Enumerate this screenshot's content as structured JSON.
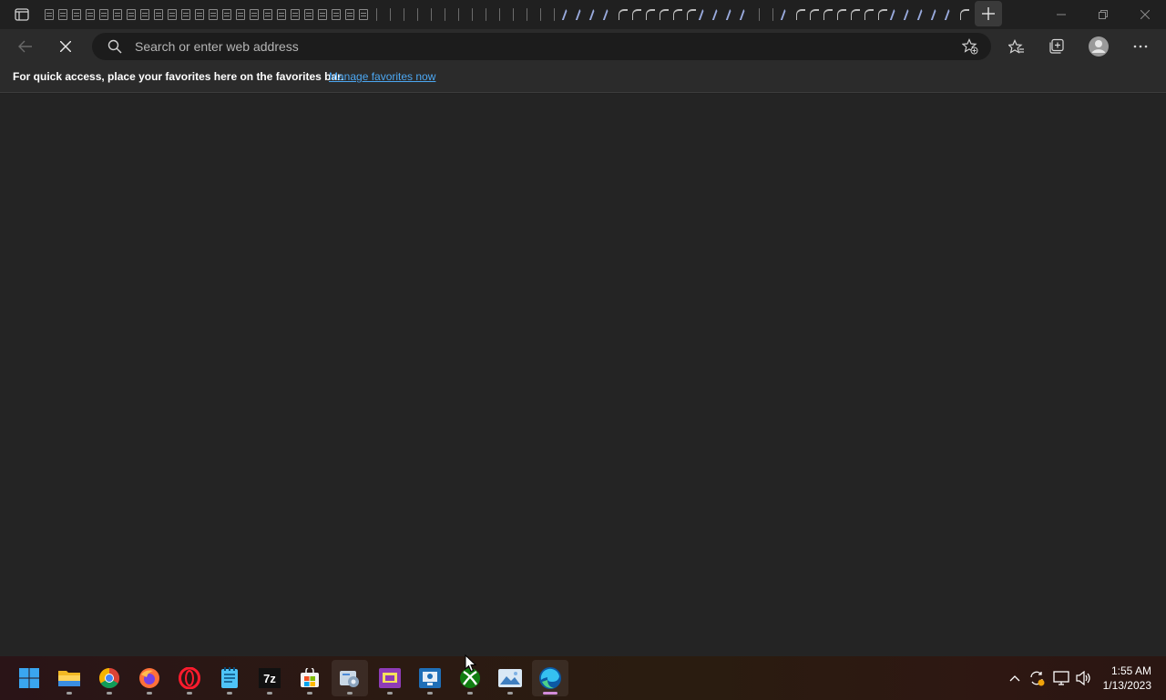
{
  "browser": {
    "address_placeholder": "Search or enter web address",
    "address_value": "",
    "favorites_bar": {
      "message": "For quick access, place your favorites here on the favorites bar.",
      "link": "Manage favorites now"
    }
  },
  "tabs": {
    "icons": [
      "page",
      "page",
      "page",
      "page",
      "page",
      "page",
      "page",
      "page",
      "page",
      "page",
      "page",
      "page",
      "page",
      "page",
      "page",
      "page",
      "page",
      "page",
      "page",
      "page",
      "page",
      "page",
      "page",
      "page",
      "bar",
      "bar",
      "bar",
      "bar",
      "bar",
      "bar",
      "bar",
      "bar",
      "bar",
      "bar",
      "bar",
      "bar",
      "bar",
      "bar",
      "spin",
      "spin",
      "spin",
      "spin",
      "spin2",
      "spin2",
      "spin2",
      "spin2",
      "spin2",
      "spin2",
      "spin",
      "spin",
      "spin",
      "spin",
      "bar",
      "bar",
      "spin",
      "spin2",
      "spin2",
      "spin2",
      "spin2",
      "spin2",
      "spin2",
      "spin2",
      "spin",
      "spin",
      "spin",
      "spin",
      "spin",
      "spin2"
    ]
  },
  "taskbar": {
    "apps": [
      {
        "name": "start-button"
      },
      {
        "name": "file-explorer-icon"
      },
      {
        "name": "chrome-icon"
      },
      {
        "name": "firefox-icon"
      },
      {
        "name": "opera-icon"
      },
      {
        "name": "notepad-icon"
      },
      {
        "name": "7zip-icon"
      },
      {
        "name": "microsoft-store-icon"
      },
      {
        "name": "control-panel-icon"
      },
      {
        "name": "presentation-app-icon"
      },
      {
        "name": "remote-desktop-icon"
      },
      {
        "name": "xbox-icon"
      },
      {
        "name": "photos-icon"
      },
      {
        "name": "edge-icon"
      }
    ],
    "clock": {
      "time": "1:55 AM",
      "date": "1/13/2023"
    }
  },
  "colors": {
    "accent_link": "#4ca7f2",
    "active_indicator": "#d38cd9"
  }
}
